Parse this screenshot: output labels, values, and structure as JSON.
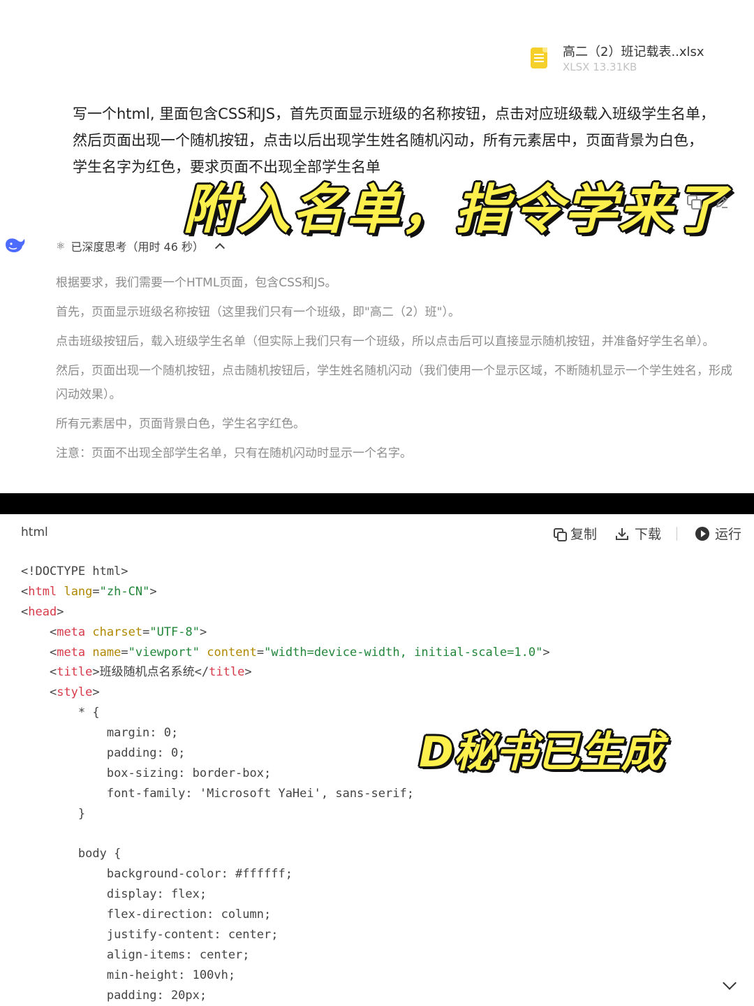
{
  "attachment": {
    "name": "高二（2）班记载表..xlsx",
    "meta": "XLSX 13.31KB"
  },
  "user_message": {
    "lines": [
      "写一个html, 里面包含CSS和JS，首先页面显示班级的名称按钮，点击对应班级载入班级学生名单，",
      "然后页面出现一个随机按钮，点击以后出现学生姓名随机闪动，所有元素居中，页面背景为白色，",
      "学生名字为红色，要求页面不出现全部学生名单"
    ]
  },
  "overlay_title": "附入名单，指令学来了",
  "thinking": {
    "header": "已深度思考（用时 46 秒）",
    "paragraphs": [
      "根据要求，我们需要一个HTML页面，包含CSS和JS。",
      " 首先，页面显示班级名称按钮（这里我们只有一个班级，即\"高二（2）班\"）。",
      " 点击班级按钮后，载入班级学生名单（但实际上我们只有一个班级，所以点击后可以直接显示随机按钮，并准备好学生名单）。",
      " 然后，页面出现一个随机按钮，点击随机按钮后，学生姓名随机闪动（我们使用一个显示区域，不断随机显示一个学生姓名，形成闪动效果）。",
      " 所有元素居中，页面背景白色，学生名字红色。",
      " 注意：页面不出现全部学生名单，只有在随机闪动时显示一个名字。"
    ]
  },
  "code_block": {
    "lang": "html",
    "copy_label": "复制",
    "download_label": "下载",
    "run_label": "运行"
  },
  "code": {
    "l1": "<!DOCTYPE html>",
    "html_lang": "zh-CN",
    "charset": "UTF-8",
    "viewport_name": "viewport",
    "viewport_content": "width=device-width, initial-scale=1.0",
    "title_text": "班级随机点名系统",
    "star_sel": "* {",
    "margin": "margin: 0;",
    "padding": "padding: 0;",
    "box_sizing": "box-sizing: border-box;",
    "font_family": "font-family: 'Microsoft YaHei', sans-serif;",
    "close_brace": "}",
    "body_sel": "body {",
    "bg": "background-color: #ffffff;",
    "display": "display: flex;",
    "flex_dir": "flex-direction: column;",
    "justify": "justify-content: center;",
    "align": "align-items: center;",
    "min_h": "min-height: 100vh;",
    "pad20": "padding: 20px;"
  },
  "overlay_sub": "D秘书已生成",
  "colors": {
    "overlay_fill": "#fdf04d",
    "tag": "#d73a49",
    "attr": "#b08800",
    "string": "#22863a",
    "file_icon": "#f5cf2a"
  },
  "icons": [
    "file-xlsx-icon",
    "copy-icon",
    "edit-icon",
    "deepseek-whale-icon",
    "atom-icon",
    "chevron-up-icon",
    "download-icon",
    "play-icon",
    "chevron-down-icon"
  ]
}
